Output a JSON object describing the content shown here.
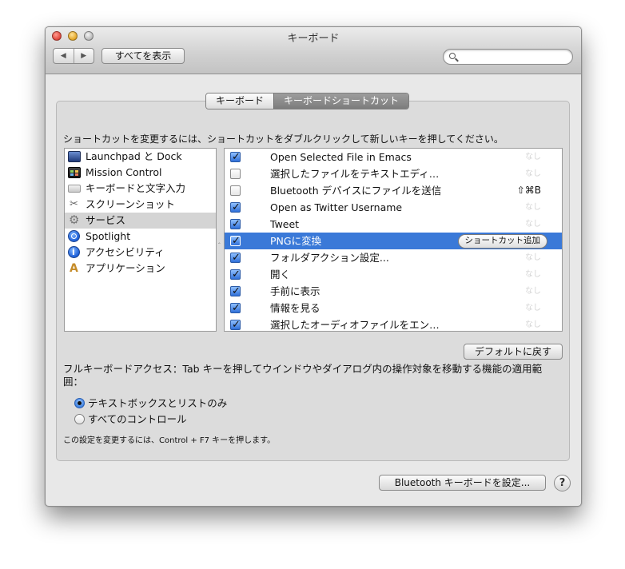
{
  "window": {
    "title": "キーボード"
  },
  "toolbar": {
    "back": "◀",
    "forward": "▶",
    "show_all": "すべてを表示",
    "search_value": ""
  },
  "tabs": [
    {
      "label": "キーボード",
      "active": false
    },
    {
      "label": "キーボードショートカット",
      "active": true
    }
  ],
  "instruction": "ショートカットを変更するには、ショートカットをダブルクリックして新しいキーを押してください。",
  "categories": [
    {
      "label": "Launchpad と Dock",
      "icon": "launchpad-icon"
    },
    {
      "label": "Mission Control",
      "icon": "mission-control-icon"
    },
    {
      "label": "キーボードと文字入力",
      "icon": "keyboard-icon"
    },
    {
      "label": "スクリーンショット",
      "icon": "screenshot-icon"
    },
    {
      "label": "サービス",
      "icon": "services-gear-icon",
      "selected": true
    },
    {
      "label": "Spotlight",
      "icon": "spotlight-icon"
    },
    {
      "label": "アクセシビリティ",
      "icon": "accessibility-icon"
    },
    {
      "label": "アプリケーション",
      "icon": "applications-icon"
    }
  ],
  "shortcuts": [
    {
      "label": "Open Selected File in Emacs",
      "checked": true,
      "key": "なし"
    },
    {
      "label": "選択したファイルをテキストエディ…",
      "checked": false,
      "key": "なし"
    },
    {
      "label": "Bluetooth デバイスにファイルを送信",
      "checked": false,
      "key": "⇧⌘B",
      "assigned": true
    },
    {
      "label": "Open as Twitter Username",
      "checked": true,
      "key": "なし"
    },
    {
      "label": "Tweet",
      "checked": true,
      "key": "なし"
    },
    {
      "label": "PNGに変換",
      "checked": true,
      "key": "ショートカット追加",
      "selected": true
    },
    {
      "label": "フォルダアクション設定...",
      "checked": true,
      "key": "なし"
    },
    {
      "label": "開く",
      "checked": true,
      "key": "なし"
    },
    {
      "label": "手前に表示",
      "checked": true,
      "key": "なし"
    },
    {
      "label": "情報を見る",
      "checked": true,
      "key": "なし"
    },
    {
      "label": "選択したオーディオファイルをエン…",
      "checked": true,
      "key": "なし"
    }
  ],
  "default_button": "デフォルトに戻す",
  "full_keyboard_access": {
    "text": "フルキーボードアクセス：Tab キーを押してウインドウやダイアログ内の操作対象を移動する機能の適用範囲：",
    "options": [
      {
        "label": "テキストボックスとリストのみ",
        "selected": true
      },
      {
        "label": "すべてのコントロール",
        "selected": false
      }
    ],
    "note": "この設定を変更するには、Control + F7 キーを押します。"
  },
  "bluetooth_button": "Bluetooth キーボードを設定...",
  "help_label": "?"
}
